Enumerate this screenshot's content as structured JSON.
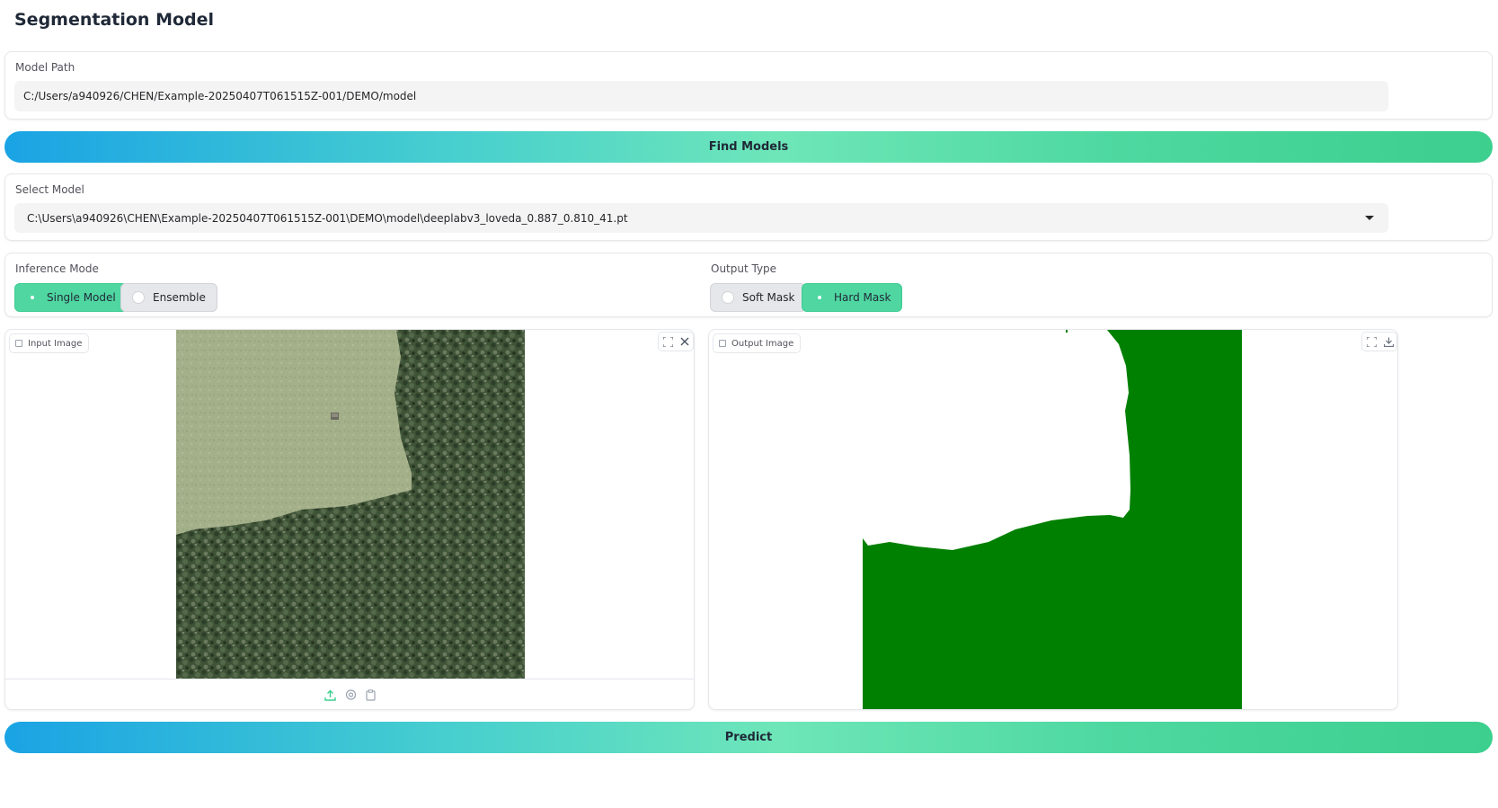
{
  "page": {
    "title": "Segmentation Model"
  },
  "model_path": {
    "label": "Model Path",
    "value": "C:/Users/a940926/CHEN/Example-20250407T061515Z-001/DEMO/model"
  },
  "find_models": {
    "label": "Find Models"
  },
  "select_model": {
    "label": "Select Model",
    "value": "C:\\Users\\a940926\\CHEN\\Example-20250407T061515Z-001\\DEMO\\model\\deeplabv3_loveda_0.887_0.810_41.pt"
  },
  "inference_mode": {
    "label": "Inference Mode",
    "options": [
      {
        "label": "Single Model",
        "selected": true
      },
      {
        "label": "Ensemble",
        "selected": false
      }
    ]
  },
  "output_type": {
    "label": "Output Type",
    "options": [
      {
        "label": "Soft Mask",
        "selected": false
      },
      {
        "label": "Hard Mask",
        "selected": true
      }
    ]
  },
  "input_image": {
    "label": "Input Image",
    "toolbar_icons": [
      "fullscreen-icon",
      "close-icon"
    ],
    "source_icons": [
      "upload-icon",
      "webcam-icon",
      "clipboard-icon"
    ]
  },
  "output_image": {
    "label": "Output Image",
    "toolbar_icons": [
      "fullscreen-icon",
      "download-icon"
    ],
    "mask_color": "#008000"
  },
  "predict": {
    "label": "Predict"
  },
  "colors": {
    "accent": "#4fd6a1",
    "gradient_start": "#1aa3e4",
    "gradient_end": "#3ccf8e"
  }
}
